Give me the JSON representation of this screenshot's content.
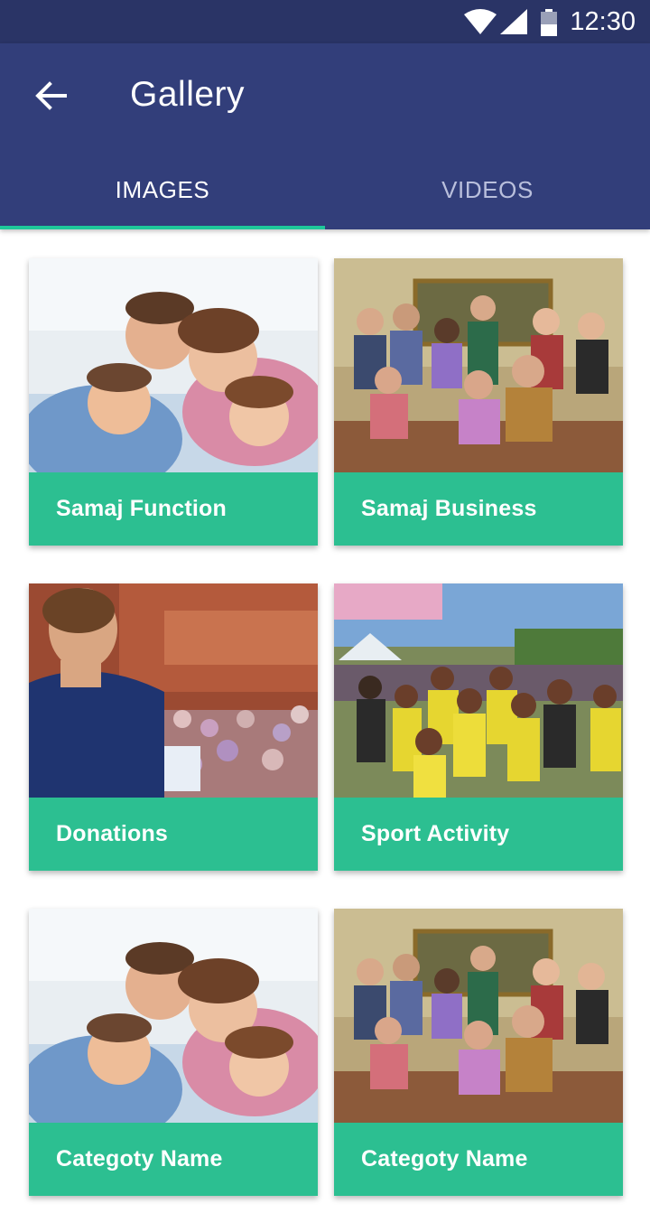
{
  "status_bar": {
    "time": "12:30"
  },
  "app_bar": {
    "title": "Gallery"
  },
  "tabs": [
    {
      "label": "IMAGES",
      "selected": true
    },
    {
      "label": "VIDEOS",
      "selected": false
    }
  ],
  "gallery": [
    {
      "caption": "Samaj Function",
      "image": "family-photo"
    },
    {
      "caption": "Samaj Business",
      "image": "group-portrait-photo"
    },
    {
      "caption": "Donations",
      "image": "conference-photo"
    },
    {
      "caption": "Sport Activity",
      "image": "event-crowd-photo"
    },
    {
      "caption": "Categoty Name",
      "image": "family-photo"
    },
    {
      "caption": "Categoty Name",
      "image": "group-portrait-photo"
    }
  ],
  "colors": {
    "status_bar": "#2a3466",
    "app_bar": "#323e7a",
    "accent": "#1ec89a"
  }
}
